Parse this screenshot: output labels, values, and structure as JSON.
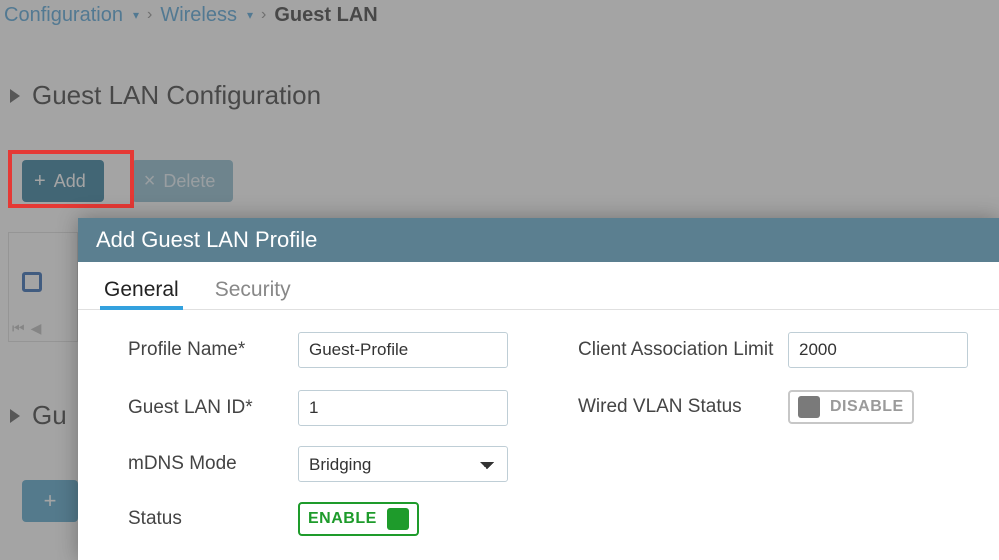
{
  "breadcrumb": {
    "configuration": "Configuration",
    "wireless": "Wireless",
    "current": "Guest LAN"
  },
  "section_title": "Guest LAN Configuration",
  "toolbar": {
    "add_label": "Add",
    "delete_label": "Delete"
  },
  "bg": {
    "section2_prefix": "Gu",
    "plus": "+"
  },
  "modal": {
    "title": "Add Guest LAN Profile",
    "tabs": {
      "general": "General",
      "security": "Security"
    },
    "fields": {
      "profile_name_label": "Profile Name*",
      "profile_name_value": "Guest-Profile",
      "guest_lan_id_label": "Guest LAN ID*",
      "guest_lan_id_value": "1",
      "mdns_label": "mDNS Mode",
      "mdns_value": "Bridging",
      "status_label": "Status",
      "status_value": "ENABLE",
      "client_assoc_label": "Client Association Limit",
      "client_assoc_value": "2000",
      "wired_vlan_label": "Wired VLAN Status",
      "wired_vlan_value": "DISABLE"
    }
  }
}
